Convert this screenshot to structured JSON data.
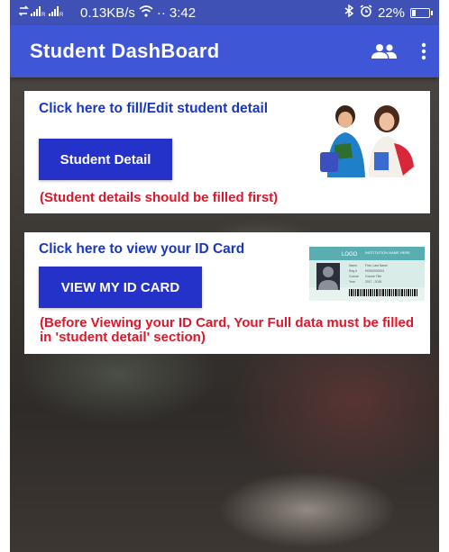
{
  "status_bar": {
    "network_speed": "0.13KB/s",
    "time": "3:42",
    "battery_percent": "22%",
    "battery_level": 0.22
  },
  "appbar": {
    "title": "Student DashBoard"
  },
  "card_detail": {
    "heading": "Click here to fill/Edit student detail",
    "button_label": "Student Detail",
    "note": "(Student details should be filled first)"
  },
  "card_id": {
    "heading": "Click here to view your ID Card",
    "button_label": "VIEW MY ID CARD",
    "note": "(Before Viewing your ID Card, Your Full data must be filled in 'student detail' section)"
  },
  "id_card_image": {
    "logo": "LOGO",
    "institution": "INSTITUTION NAME HERE",
    "rows": [
      {
        "label": "Name",
        "value": "First, Last Name"
      },
      {
        "label": "Reg #",
        "value": "H0000000001"
      },
      {
        "label": "Course",
        "value": "Course Title"
      },
      {
        "label": "Year",
        "value": "2017 - 2018"
      }
    ]
  },
  "colors": {
    "appbar": "#3f57d6",
    "statusbar": "#3f51b5",
    "button": "#2432c9",
    "heading": "#1a37c4",
    "note": "#e0162b"
  },
  "icons": [
    "signal-icon",
    "wifi-icon",
    "bluetooth-icon",
    "alarm-icon",
    "battery-icon",
    "people-icon",
    "more-vert-icon"
  ]
}
